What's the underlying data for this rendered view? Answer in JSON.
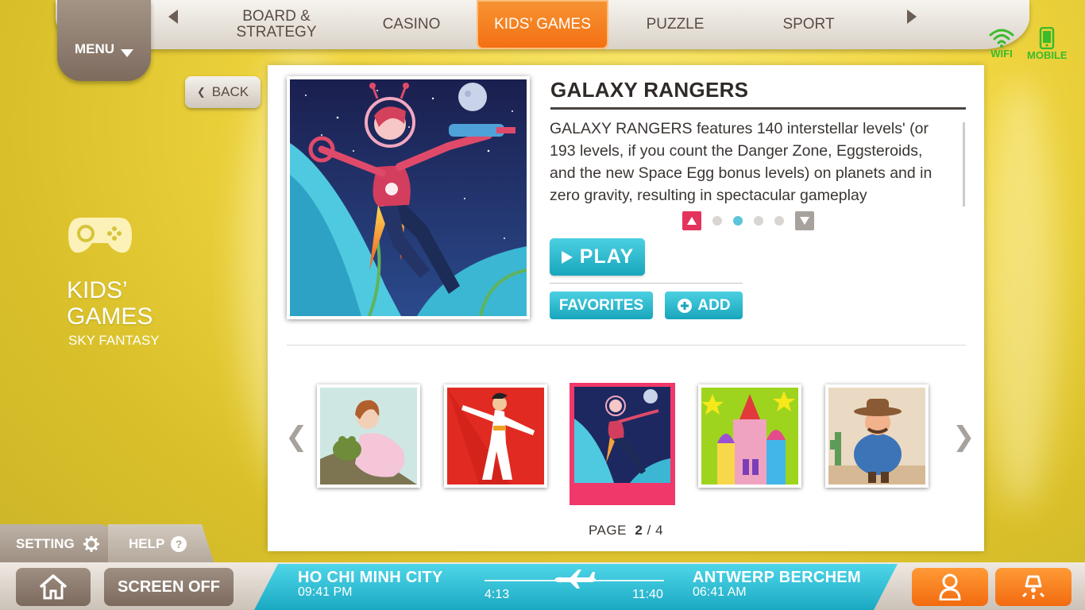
{
  "menu": {
    "label": "MENU"
  },
  "categories": [
    {
      "label": "BOARD &\nSTRATEGY",
      "active": false
    },
    {
      "label": "CASINO",
      "active": false
    },
    {
      "label": "KIDS’ GAMES",
      "active": true
    },
    {
      "label": "PUZZLE",
      "active": false
    },
    {
      "label": "SPORT",
      "active": false
    }
  ],
  "status": {
    "wifi_label": "WIFI",
    "mobile_label": "MOBILE"
  },
  "back_label": "BACK",
  "left_panel": {
    "title": "KIDS’\nGAMES",
    "subtitle": "SKY FANTASY",
    "icon": "gamepad-icon"
  },
  "game": {
    "title": "GALAXY RANGERS",
    "description": "GALAXY RANGERS features 140 interstellar levels' (or 193 levels, if you count the Danger Zone, Eggsteroids, and the new Space Egg bonus levels) on planets and in zero gravity, resulting in spectacular gameplay",
    "description_page": 2,
    "description_pages": 4,
    "play_label": "PLAY",
    "favorites_label": "FAVORITES",
    "add_label": "ADD"
  },
  "thumbnails": [
    {
      "name": "princess-frog",
      "active": false
    },
    {
      "name": "disco-dancer",
      "active": false
    },
    {
      "name": "galaxy-rangers",
      "active": true
    },
    {
      "name": "colorful-palace",
      "active": false
    },
    {
      "name": "cowboy",
      "active": false
    }
  ],
  "paging": {
    "prefix": "PAGE",
    "current": "2",
    "separator": "/",
    "total": "4"
  },
  "bottom": {
    "setting_label": "SETTING",
    "help_label": "HELP",
    "screen_off_label": "SCREEN OFF",
    "flight": {
      "origin_city": "HO CHI MINH CITY",
      "origin_time": "09:41 PM",
      "elapsed": "4:13",
      "remaining": "11:40",
      "dest_city": "ANTWERP BERCHEM",
      "dest_time": "06:41 AM"
    }
  },
  "colors": {
    "accent_orange": "#f36f12",
    "accent_teal": "#18a5bb",
    "highlight_pink": "#f0386a",
    "wifi_green": "#3cbb2a"
  }
}
